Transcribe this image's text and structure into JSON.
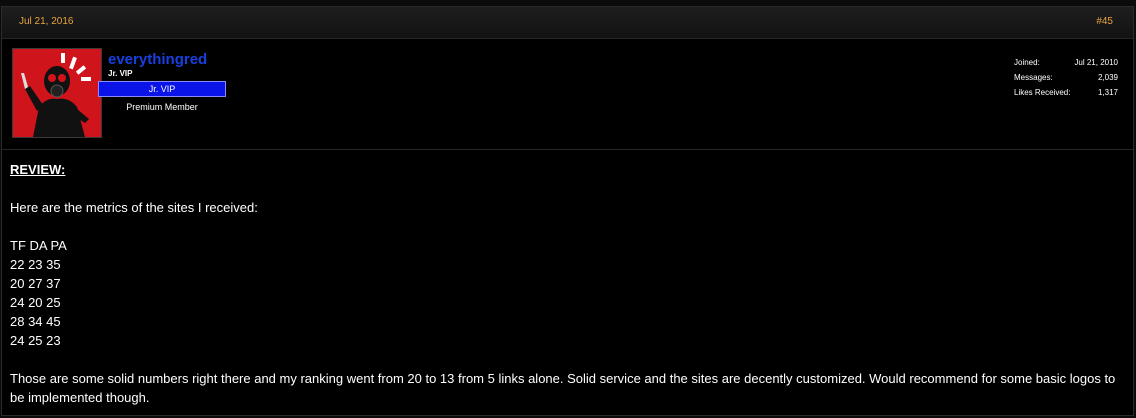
{
  "post": {
    "date": "Jul 21, 2016",
    "number": "#45"
  },
  "user": {
    "username": "everythingred",
    "title": "Jr. VIP",
    "banner": "Jr. VIP",
    "member_type": "Premium Member",
    "avatar_icon": "gas-mask-figure-avatar",
    "colors": {
      "username": "#1a3fe0",
      "banner_bg": "#0a14e8",
      "avatar_bg": "#d0141c",
      "date": "#e8a33c"
    }
  },
  "stats": {
    "joined_label": "Joined:",
    "joined_value": "Jul 21, 2010",
    "messages_label": "Messages:",
    "messages_value": "2,039",
    "likes_label": "Likes Received:",
    "likes_value": "1,317"
  },
  "body": {
    "heading": "REVIEW:",
    "intro": "Here are the metrics of the sites I received:",
    "table_header": "TF DA PA",
    "rows": [
      "22 23 35",
      "20 27 37",
      "24 20 25",
      "28 34 45",
      "24 25 23"
    ],
    "conclusion": "Those are some solid numbers right there and my ranking went from 20 to 13 from 5 links alone. Solid service and the sites are decently customized. Would recommend for some basic logos to be implemented though."
  }
}
